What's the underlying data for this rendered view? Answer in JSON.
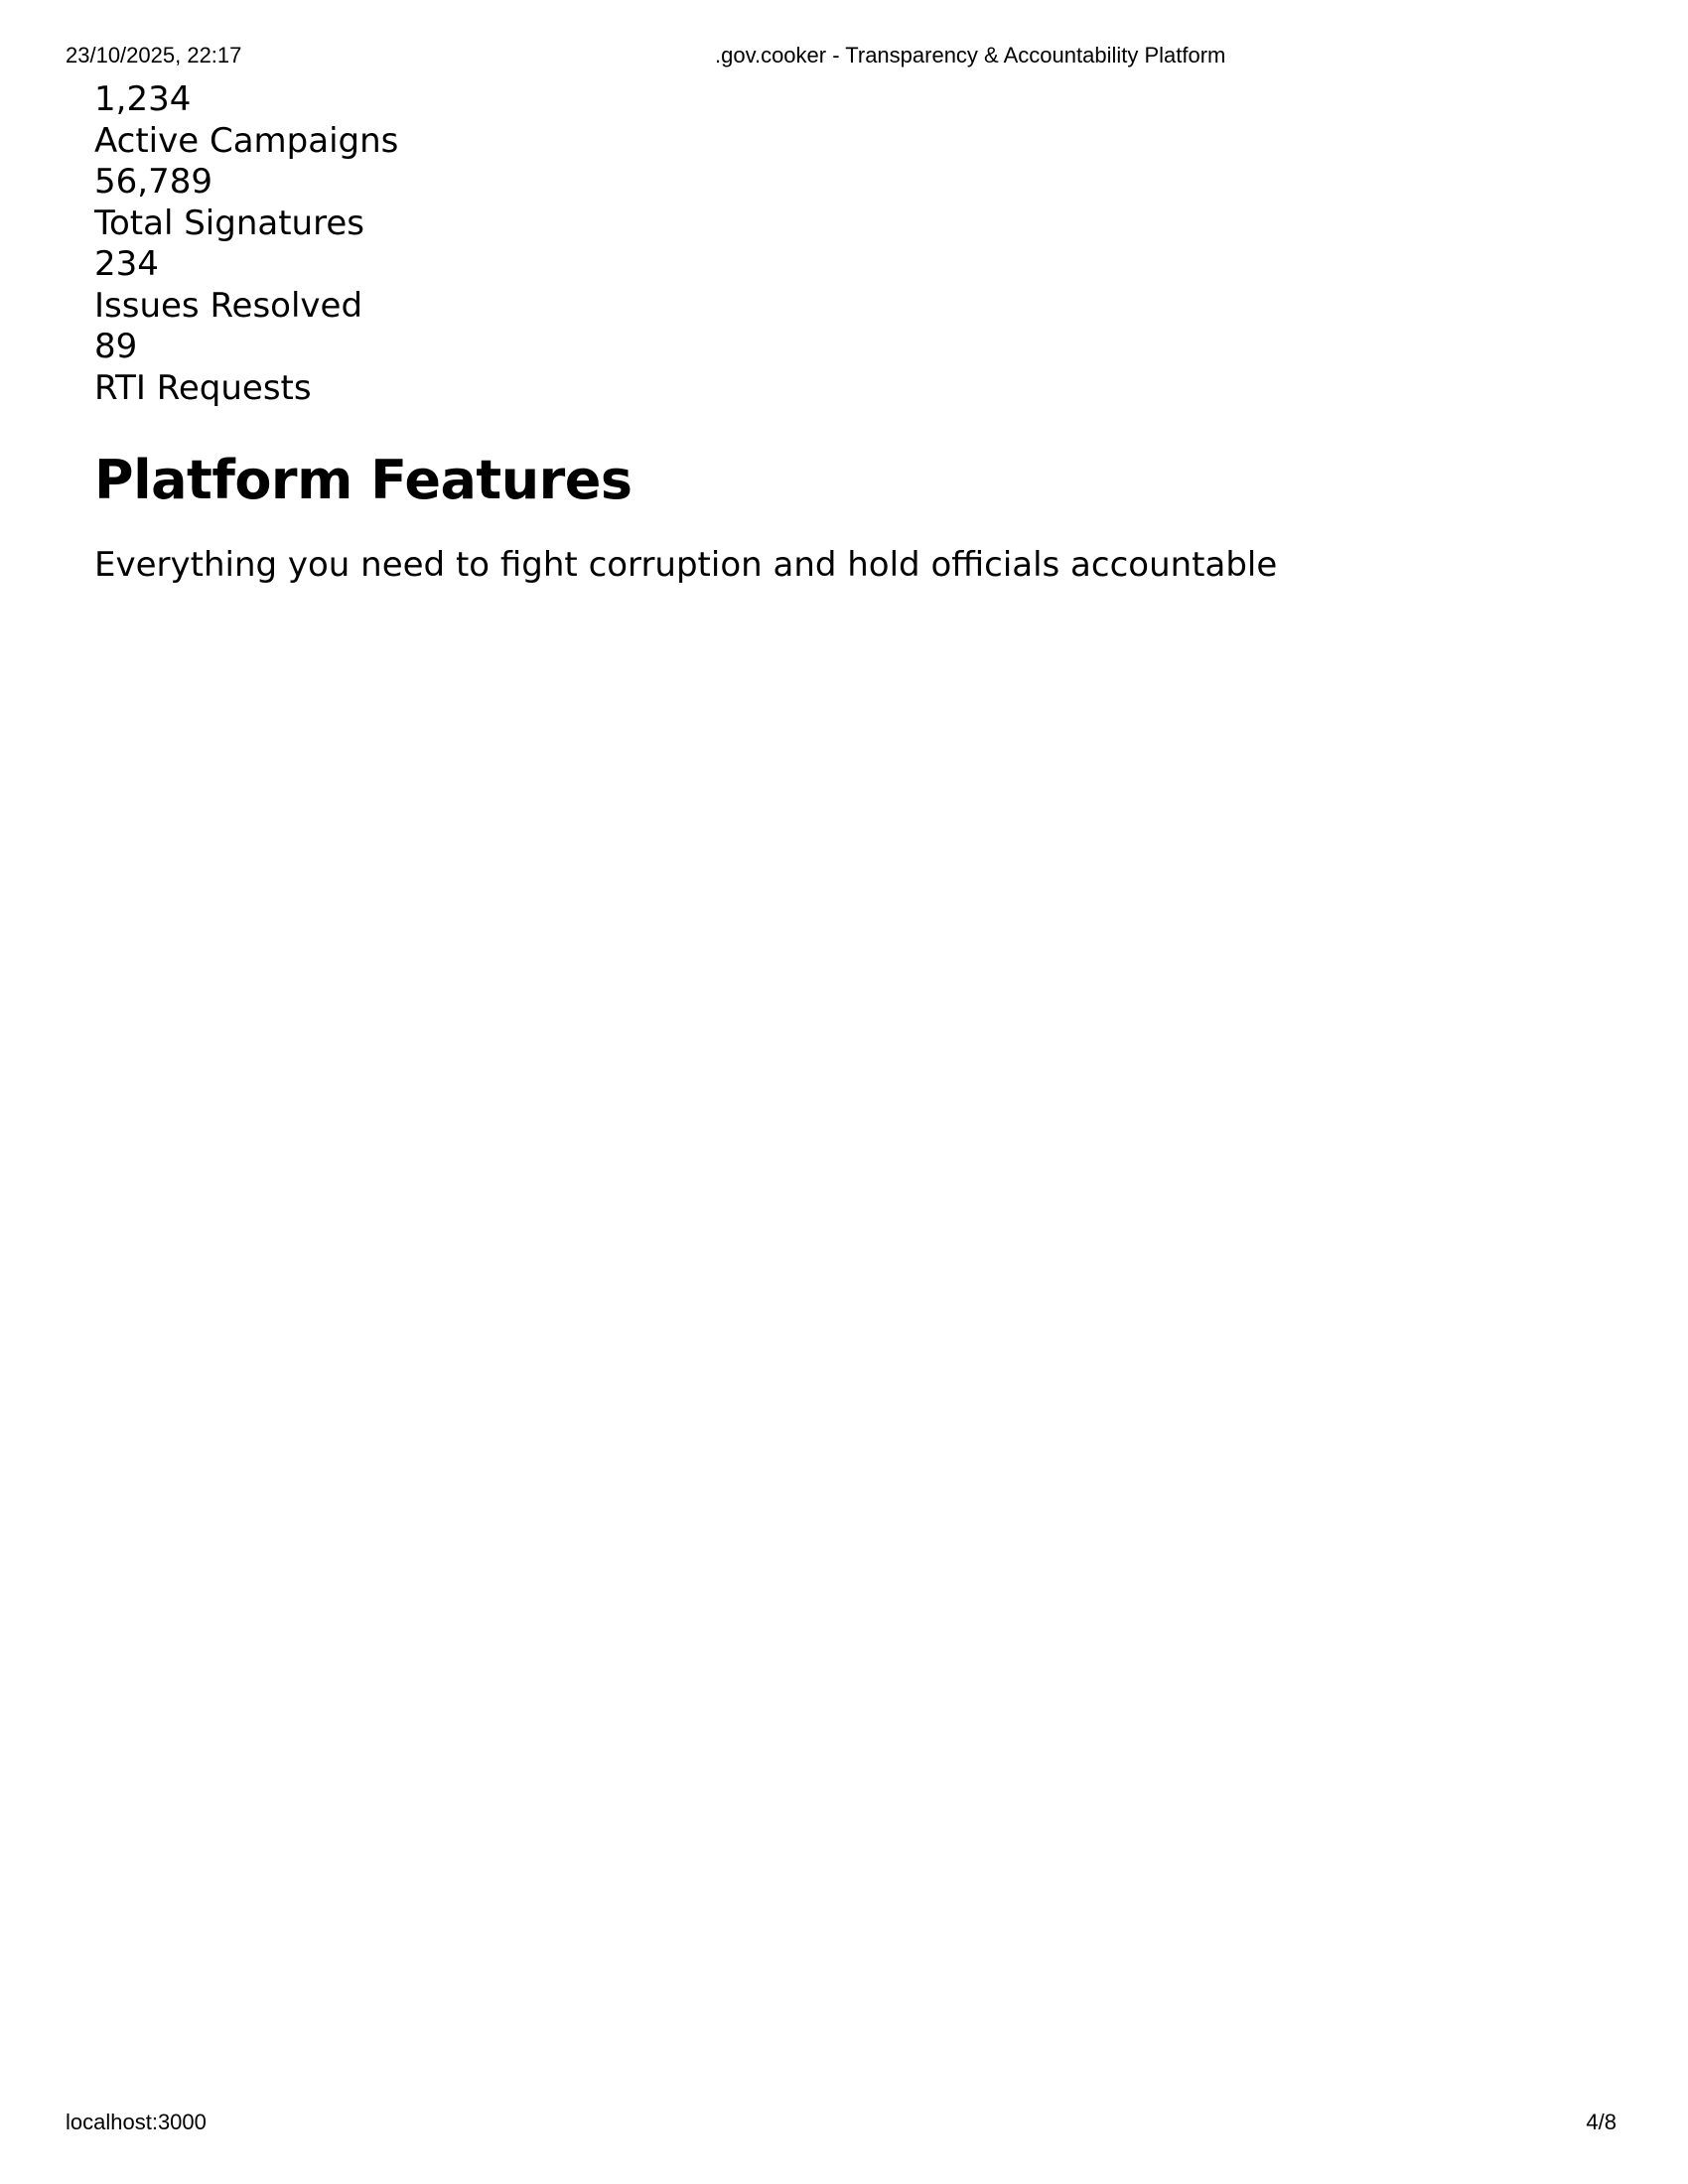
{
  "print_header": {
    "datetime": "23/10/2025, 22:17",
    "title": ".gov.cooker - Transparency & Accountability Platform"
  },
  "stats": [
    {
      "value": "1,234",
      "label": "Active Campaigns"
    },
    {
      "value": "56,789",
      "label": "Total Signatures"
    },
    {
      "value": "234",
      "label": "Issues Resolved"
    },
    {
      "value": "89",
      "label": "RTI Requests"
    }
  ],
  "features": {
    "title": "Platform Features",
    "subtitle": "Everything you need to fight corruption and hold officials accountable"
  },
  "print_footer": {
    "url": "localhost:3000",
    "page": "4/8"
  }
}
